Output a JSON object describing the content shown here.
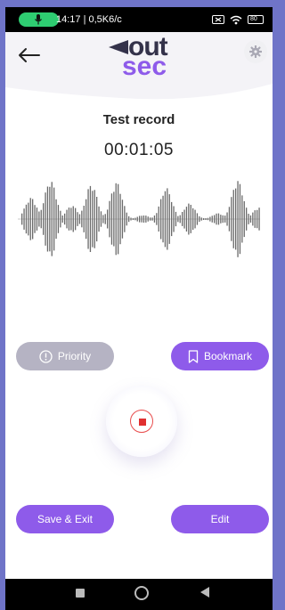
{
  "status_bar": {
    "text": "14:17 | 0,5K6/c",
    "battery": "80"
  },
  "header": {
    "logo_top": "out",
    "logo_bottom": "sec"
  },
  "recording": {
    "title": "Test record",
    "timer": "00:01:05",
    "state": "recording"
  },
  "actions": {
    "priority_label": "Priority",
    "bookmark_label": "Bookmark",
    "save_exit_label": "Save & Exit",
    "edit_label": "Edit"
  },
  "icons": {
    "back": "arrow-left-icon",
    "settings": "gear-icon",
    "priority": "exclamation-circle-icon",
    "bookmark": "bookmark-icon",
    "stop": "stop-icon"
  },
  "colors": {
    "accent": "#8e5bea",
    "disabled": "#b5b3c3",
    "record": "#e03030",
    "logo_dark": "#34324a"
  }
}
